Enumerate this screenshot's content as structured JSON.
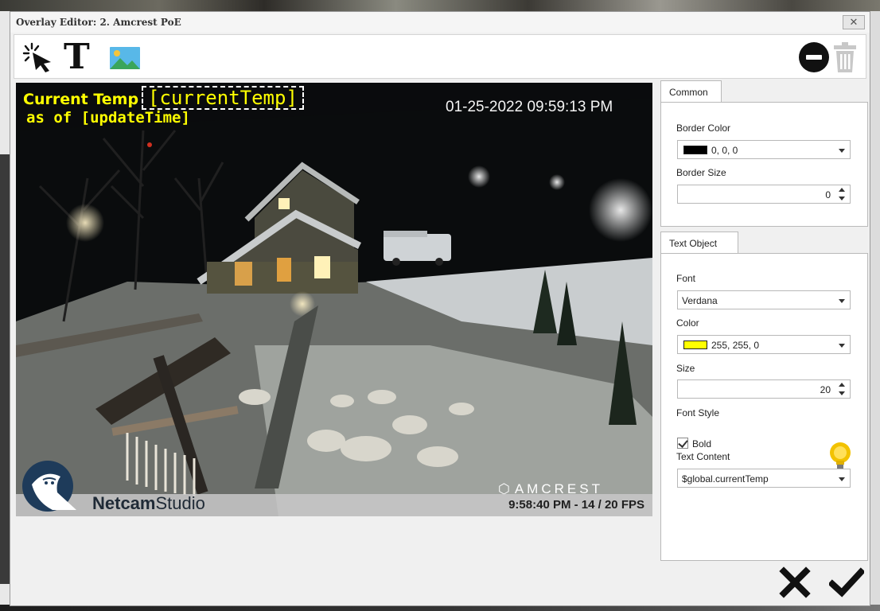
{
  "window": {
    "title": "Overlay Editor: 2. Amcrest PoE",
    "close_label": "✕"
  },
  "toolbar": {
    "text_tool_label": "T"
  },
  "video": {
    "overlay_temp_label": "Current Temp",
    "overlay_temp_tag": "[currentTemp]",
    "overlay_asof": "as of [updateTime]",
    "datetime": "01-25-2022 09:59:13 PM",
    "camera_brand": "AMCREST",
    "app_brand_bold": "Netcam",
    "app_brand_rest": "Studio",
    "fps_status": "9:58:40 PM - 14 / 20 FPS"
  },
  "common_panel": {
    "tab_label": "Common",
    "border_color_label": "Border Color",
    "border_color_value": "0, 0, 0",
    "border_color_hex": "#000000",
    "border_size_label": "Border Size",
    "border_size_value": "0"
  },
  "text_panel": {
    "tab_label": "Text Object",
    "font_label": "Font",
    "font_value": "Verdana",
    "color_label": "Color",
    "color_value": "255, 255, 0",
    "color_hex": "#ffff00",
    "size_label": "Size",
    "size_value": "20",
    "font_style_label": "Font Style",
    "bold_label": "Bold",
    "bold_checked": true,
    "text_content_label": "Text Content",
    "text_content_value": "$global.currentTemp"
  },
  "icons": {
    "select_tool": "cursor-select-icon",
    "text_tool": "text-tool-icon",
    "image_tool": "image-tool-icon",
    "remove": "minus-circle-icon",
    "delete": "trash-icon",
    "hint": "lightbulb-icon",
    "cancel": "x-cancel-icon",
    "confirm": "checkmark-icon"
  }
}
